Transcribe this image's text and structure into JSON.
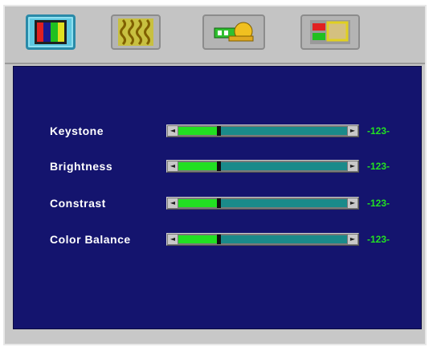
{
  "tabs": [
    {
      "icon": "color-bars-icon",
      "active": true
    },
    {
      "icon": "wavy-lines-icon",
      "active": false
    },
    {
      "icon": "key-tool-icon",
      "active": false
    },
    {
      "icon": "picture-settings-icon",
      "active": false
    }
  ],
  "settings": [
    {
      "label": "Keystone",
      "value": "-123-",
      "level": 0.23
    },
    {
      "label": "Brightness",
      "value": "-123-",
      "level": 0.23
    },
    {
      "label": "Constrast",
      "value": "-123-",
      "level": 0.23
    },
    {
      "label": "Color Balance",
      "value": "-123-",
      "level": 0.23
    }
  ],
  "colors": {
    "panel_background": "#14146e",
    "value_text": "#22e022",
    "slider_fill": "#22e022",
    "slider_trough": "#1a8a8a",
    "active_tab": "#5ec8e0"
  }
}
